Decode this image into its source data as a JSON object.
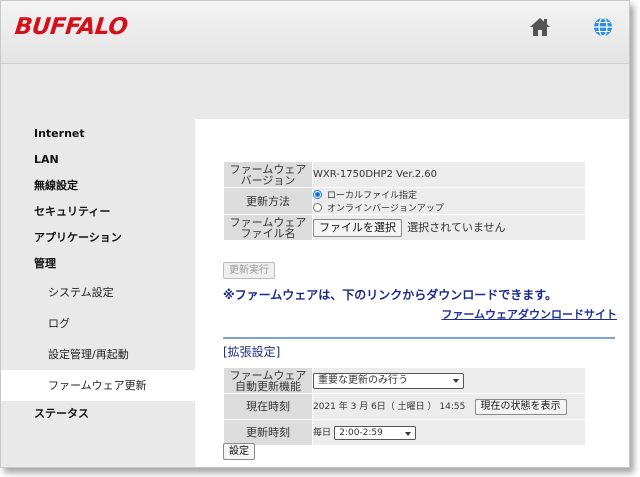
{
  "brand": {
    "logo": "BUFFALO",
    "accent": "#d4101a"
  },
  "header": {
    "home_icon": "home-icon",
    "language_icon": "globe-icon"
  },
  "sidebar": {
    "items": [
      {
        "label": "Internet"
      },
      {
        "label": "LAN"
      },
      {
        "label": "無線設定"
      },
      {
        "label": "セキュリティー"
      },
      {
        "label": "アプリケーション"
      },
      {
        "label": "管理"
      }
    ],
    "sub_items": [
      {
        "label": "システム設定"
      },
      {
        "label": "ログ"
      },
      {
        "label": "設定管理/再起動"
      },
      {
        "label": "ファームウェア更新",
        "active": true
      }
    ],
    "last_item": {
      "label": "ステータス"
    }
  },
  "firmware": {
    "version_label_1": "ファームウェア",
    "version_label_2": "バージョン",
    "version_value": "WXR-1750DHP2 Ver.2.60",
    "method_label": "更新方法",
    "method_local": "ローカルファイル指定",
    "method_online": "オンラインバージョンアップ",
    "file_label_1": "ファームウェア",
    "file_label_2": "ファイル名",
    "file_button": "ファイルを選択",
    "file_status": "選択されていません",
    "execute_button": "更新実行",
    "note": "※ファームウェアは、下のリンクからダウンロードできます。",
    "download_link": "ファームウェアダウンロードサイト"
  },
  "advanced": {
    "title": "[拡張設定]",
    "auto_label_1": "ファームウェア",
    "auto_label_2": "自動更新機能",
    "auto_value": "重要な更新のみ行う",
    "current_time_label": "現在時刻",
    "current_time_value": "2021 年 3 月 6日（ 土曜日 ） 14:55",
    "show_status_button": "現在の状態を表示",
    "update_time_label": "更新時刻",
    "update_time_prefix": "毎日",
    "update_time_value": "2:00-2:59",
    "save_button": "設定"
  }
}
